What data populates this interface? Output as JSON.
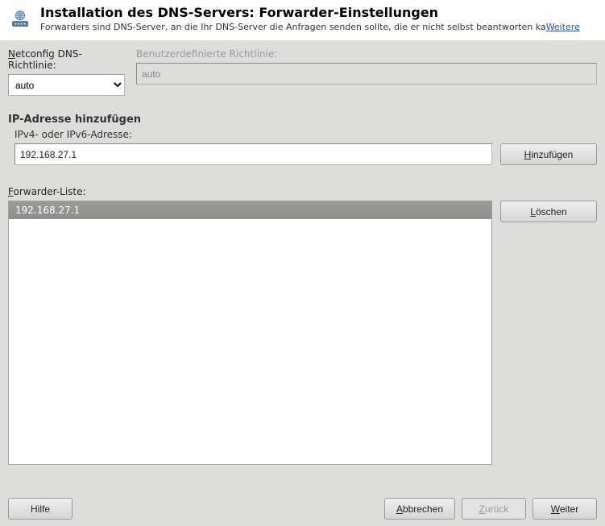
{
  "header": {
    "title": "Installation des DNS-Servers: Forwarder-Einstellungen",
    "subtitle_prefix": "Forwarders sind DNS-Server, an die Ihr DNS-Server die Anfragen senden sollte, die er nicht selbst beantworten ka",
    "weitere": "Weitere"
  },
  "policy": {
    "label": "Netconfig DNS-Richtlinie:",
    "value": "auto",
    "custom_label": "Benutzerdefinierte Richtlinie:",
    "custom_value": "auto"
  },
  "add_section": {
    "title": "IP-Adresse hinzufügen",
    "sublabel": "IPv4- oder IPv6-Adresse:",
    "value": "192.168.27.1",
    "add_btn_pre": "H",
    "add_btn_rest": "inzufügen"
  },
  "list": {
    "label": "Forwarder-Liste:",
    "items": [
      "192.168.27.1"
    ],
    "delete_btn_pre": "L",
    "delete_btn_rest": "öschen"
  },
  "footer": {
    "help": "Hilfe",
    "abort_pre": "A",
    "abort_rest": "bbrechen",
    "back_pre": "Z",
    "back_rest": "urück",
    "next_pre": "W",
    "next_rest": "eiter"
  }
}
